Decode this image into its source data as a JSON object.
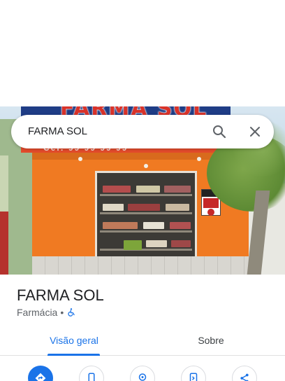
{
  "search": {
    "query": "FARMA SOL"
  },
  "place": {
    "name": "FARMA SOL",
    "category": "Farmácia",
    "separator": "•"
  },
  "tabs": [
    {
      "label": "Visão geral",
      "active": true
    },
    {
      "label": "Sobre",
      "active": false
    }
  ],
  "actions": [
    {
      "icon": "directions-icon"
    },
    {
      "icon": "phone-icon"
    },
    {
      "icon": "location-pin-icon"
    },
    {
      "icon": "save-to-phone-icon"
    },
    {
      "icon": "share-icon"
    }
  ],
  "photo": {
    "sign_text": "FARMA SOL",
    "sign_sub": "Cel: 99 99 99 99"
  },
  "colors": {
    "accent": "#1a73e8",
    "text_primary": "#202124",
    "text_secondary": "#5f6368"
  }
}
